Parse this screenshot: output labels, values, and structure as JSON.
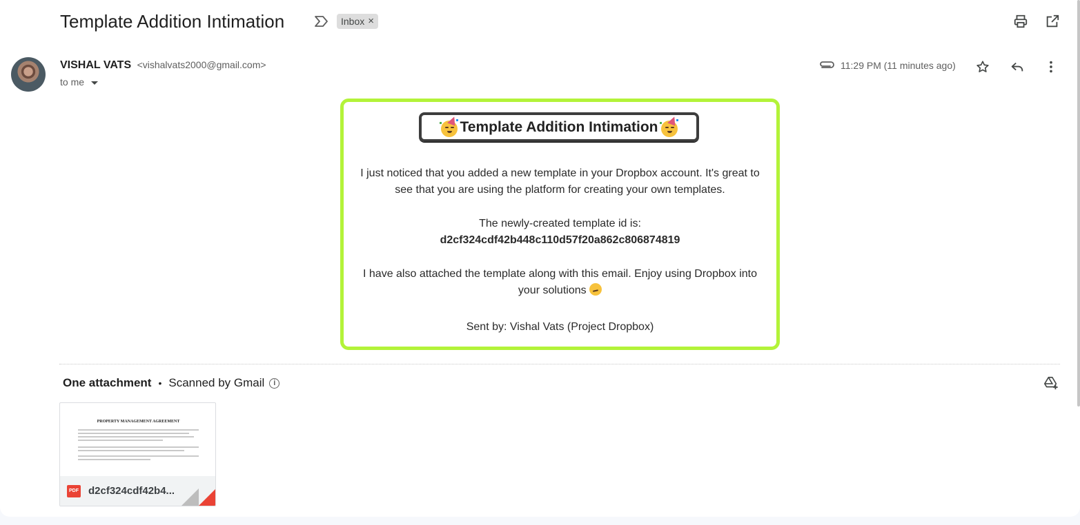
{
  "email": {
    "subject": "Template Addition Intimation",
    "label": "Inbox",
    "label_remove": "×",
    "sender_name": "VISHAL VATS",
    "sender_email": "<vishalvats2000@gmail.com>",
    "recipient": "to me",
    "timestamp": "11:29 PM (11 minutes ago)"
  },
  "icons": {
    "importance": "label-importance-icon",
    "print": "print-icon",
    "popout": "open-in-new-window-icon",
    "attachment_clip": "paperclip-icon",
    "star": "star-icon",
    "reply": "reply-icon",
    "more": "more-vert-icon",
    "drive": "add-to-drive-icon",
    "info": "info-icon"
  },
  "body": {
    "title": "Template Addition Intimation",
    "p1": "I just noticed that you added a new template in your Dropbox account. It's great to see that you are using the platform for creating your own templates.",
    "p2_label": "The newly-created template id is:",
    "template_id": "d2cf324cdf42b448c110d57f20a862c806874819",
    "p3": "I have also attached the template along with this email. Enjoy using Dropbox into your solutions",
    "signature": "Sent by: Vishal Vats (Project Dropbox)"
  },
  "attachments": {
    "count_label": "One attachment",
    "separator": "•",
    "scan_status": "Scanned by Gmail",
    "info_glyph": "i",
    "file": {
      "type_badge": "PDF",
      "name": "d2cf324cdf42b4...",
      "preview_title": "PROPERTY MANAGEMENT AGREEMENT"
    }
  },
  "colors": {
    "card_border": "#b3f339",
    "title_border": "#3d3d3d",
    "pdf_red": "#ea4335"
  }
}
